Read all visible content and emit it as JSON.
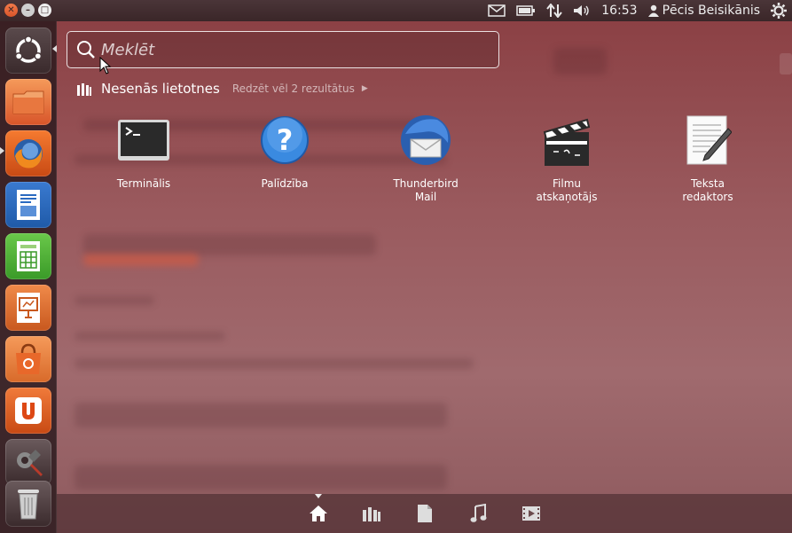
{
  "top_panel": {
    "clock": "16:53",
    "user": "Pēcis Beisikānis",
    "icons": [
      "mail-icon",
      "battery-icon",
      "network-icon",
      "volume-icon",
      "user-icon",
      "session-gear-icon"
    ]
  },
  "launcher": {
    "items": [
      {
        "name": "dash-home",
        "icon": "ubuntu-logo-icon"
      },
      {
        "name": "files",
        "icon": "folder-icon"
      },
      {
        "name": "firefox",
        "icon": "firefox-icon"
      },
      {
        "name": "writer",
        "icon": "writer-icon"
      },
      {
        "name": "calc",
        "icon": "calc-icon"
      },
      {
        "name": "impress",
        "icon": "impress-icon"
      },
      {
        "name": "software-center",
        "icon": "shopping-bag-icon"
      },
      {
        "name": "ubuntu-one",
        "icon": "ubuntu-one-icon"
      },
      {
        "name": "system-settings",
        "icon": "settings-icon"
      },
      {
        "name": "trash",
        "icon": "trash-icon"
      }
    ]
  },
  "search": {
    "placeholder": "Meklēt",
    "value": ""
  },
  "category": {
    "title": "Nesenās lietotnes",
    "more": "Redzēt vēl 2 rezultātus"
  },
  "apps": [
    {
      "line1": "Terminālis",
      "line2": "",
      "icon": "terminal-icon"
    },
    {
      "line1": "Palīdzība",
      "line2": "",
      "icon": "help-icon"
    },
    {
      "line1": "Thunderbird",
      "line2": "Mail",
      "icon": "thunderbird-icon"
    },
    {
      "line1": "Filmu",
      "line2": "atskaņotājs",
      "icon": "clapperboard-icon"
    },
    {
      "line1": "Teksta",
      "line2": "redaktors",
      "icon": "text-editor-icon"
    }
  ],
  "lenses": [
    "home-lens-icon",
    "applications-lens-icon",
    "files-lens-icon",
    "music-lens-icon",
    "video-lens-icon"
  ],
  "colors": {
    "accent": "#dd4814",
    "panel": "#3a2628",
    "dash_tint": "#9a5a5e"
  }
}
